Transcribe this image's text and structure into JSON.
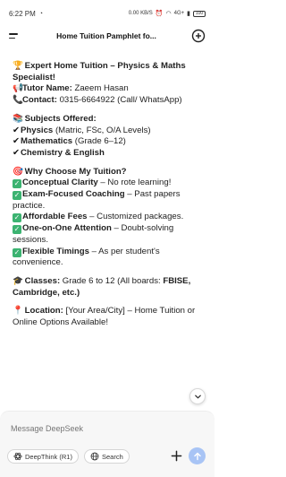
{
  "status_bar": {
    "time": "6:22 PM",
    "left_icon": "whatsapp-icon",
    "speed": "0.00 KB/S",
    "network": "4G+",
    "battery": "100"
  },
  "header": {
    "title": "Home Tuition Pamphlet fo..."
  },
  "message": {
    "headline_emoji": "🏆",
    "headline": "Expert Home Tuition – Physics & Maths Specialist!",
    "tutor_emoji": "📢",
    "tutor_label": "Tutor Name:",
    "tutor_value": " Zaeem Hasan",
    "contact_emoji": "📞",
    "contact_label": "Contact:",
    "contact_value": " 0315-6664922 (Call/ WhatsApp)",
    "subjects_emoji": "📚",
    "subjects_heading": "Subjects Offered:",
    "subjects": [
      {
        "tick": "✔",
        "name": "Physics",
        "detail": " (Matric, FSc, O/A Levels)"
      },
      {
        "tick": "✔",
        "name": "Mathematics",
        "detail": " (Grade 6–12)"
      },
      {
        "tick": "✔",
        "name": "Chemistry & English",
        "detail": ""
      }
    ],
    "why_emoji": "🎯",
    "why_heading": "Why Choose My Tuition?",
    "reasons": [
      {
        "name": "Conceptual Clarity",
        "detail": " – No rote learning!"
      },
      {
        "name": "Exam-Focused Coaching",
        "detail": " – Past papers practice."
      },
      {
        "name": "Affordable Fees",
        "detail": " – Customized packages."
      },
      {
        "name": "One-on-One Attention",
        "detail": " – Doubt-solving sessions."
      },
      {
        "name": "Flexible Timings",
        "detail": " – As per student's convenience."
      }
    ],
    "classes_emoji": "🎓",
    "classes_label": "Classes:",
    "classes_value": " Grade 6 to 12 (All boards: ",
    "classes_boards": "FBISE, Cambridge, etc.)",
    "location_emoji": "📍",
    "location_label": "Location:",
    "location_value": " [Your Area/City] – Home Tuition or Online Options Available!"
  },
  "composer": {
    "placeholder": "Message DeepSeek",
    "deepthink_label": "DeepThink (R1)",
    "search_label": "Search"
  },
  "colors": {
    "check_green": "#3cb371",
    "send_blue": "#a8c4f5"
  }
}
